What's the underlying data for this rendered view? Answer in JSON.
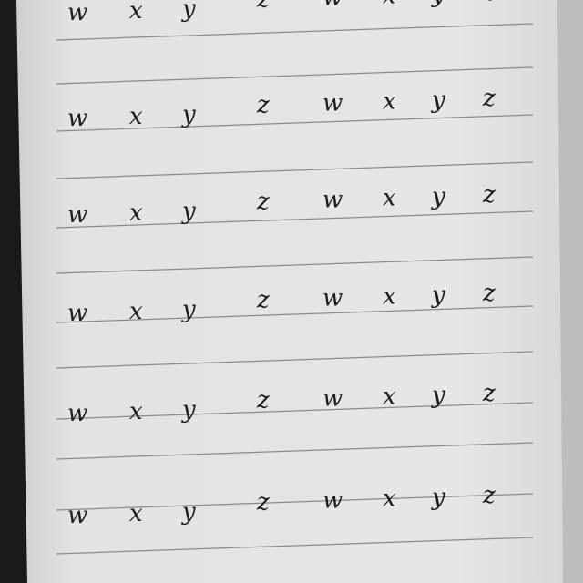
{
  "notebook": {
    "rows": [
      [
        "w",
        "x",
        "y",
        "z",
        "w",
        "x",
        "y",
        "z"
      ],
      [
        "w",
        "x",
        "y",
        "z",
        "w",
        "x",
        "y",
        "z"
      ],
      [
        "w",
        "x",
        "y",
        "z",
        "w",
        "x",
        "y",
        "z"
      ],
      [
        "w",
        "x",
        "y",
        "z",
        "w",
        "x",
        "y",
        "z"
      ],
      [
        "w",
        "x",
        "y",
        "z",
        "w",
        "x",
        "y",
        "z"
      ],
      [
        "w",
        "x",
        "y",
        "z",
        "w",
        "x",
        "y",
        "z"
      ]
    ]
  },
  "colors": {
    "paper": "#e4e4e4",
    "line": "#8a8a8a",
    "ink": "#1c1c1c",
    "background": "#1a1a1a"
  }
}
